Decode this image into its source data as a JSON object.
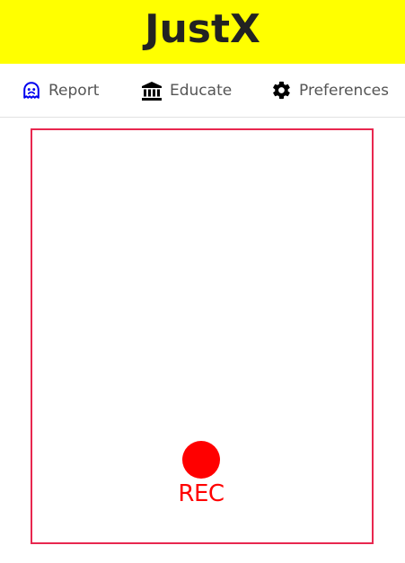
{
  "header": {
    "title": "JustX",
    "background_color": "#ffff00"
  },
  "nav": {
    "items": [
      {
        "label": "Report",
        "icon": "ghost-face-icon",
        "icon_color": "#0000ee"
      },
      {
        "label": "Educate",
        "icon": "bank-building-icon",
        "icon_color": "#000000"
      },
      {
        "label": "Preferences",
        "icon": "gear-icon",
        "icon_color": "#000000"
      }
    ]
  },
  "recorder": {
    "frame_color": "#e8274f",
    "record_label": "REC",
    "record_color": "#ff0000"
  }
}
